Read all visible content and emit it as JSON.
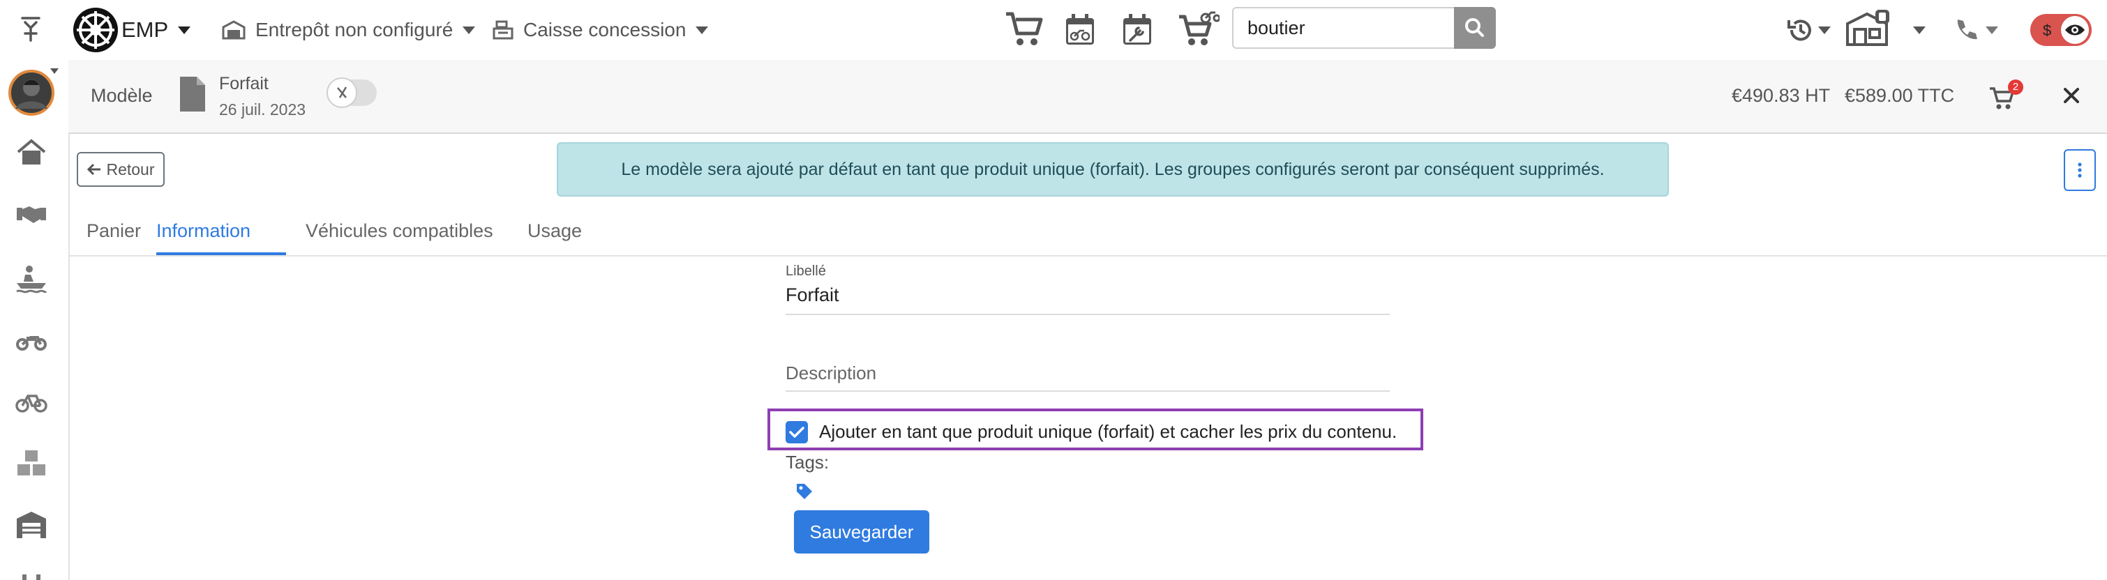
{
  "topbar": {
    "brand": "EMP",
    "warehouse": "Entrepôt non configuré",
    "register": "Caisse concession",
    "search": {
      "value": "boutier",
      "placeholder": ""
    },
    "accent": "#9c9c9c"
  },
  "subheader": {
    "model_label": "Modèle",
    "doc_title": "Forfait",
    "doc_date": "26 juil. 2023",
    "price_ht": "€490.83 HT",
    "price_ttc": "€589.00 TTC",
    "cart_badge": "2",
    "toggle_on": false
  },
  "content": {
    "back_label": "Retour",
    "alert_text": "Le modèle sera ajouté par défaut en tant que produit unique (forfait). Les groupes configurés seront par conséquent supprimés.",
    "tabs": [
      {
        "label": "Panier",
        "active": false
      },
      {
        "label": "Information",
        "active": true
      },
      {
        "label": "Véhicules compatibles",
        "active": false
      },
      {
        "label": "Usage",
        "active": false
      }
    ],
    "form": {
      "libelle_label": "Libellé",
      "libelle_value": "Forfait",
      "description_label": "Description",
      "checkbox_label": "Ajouter en tant que produit unique (forfait) et cacher les prix du contenu.",
      "checkbox_checked": true,
      "tags_label": "Tags:",
      "save_label": "Sauvegarder"
    }
  },
  "colors": {
    "primary": "#2f7be0",
    "alert_bg": "#bfe4e8",
    "alert_border": "#9fd1d7",
    "highlight": "#8e3fb3",
    "badge": "#e53935",
    "danger_toggle": "#d9534f"
  },
  "icons": [
    "pin-icon",
    "logo-icon",
    "warehouse-icon",
    "cash-register-icon",
    "cart-icon",
    "moto-calendar-icon",
    "repair-calendar-icon",
    "moto-cart-icon",
    "search-icon",
    "history-icon",
    "shop-icon",
    "phone-icon",
    "eye-icon",
    "home-icon",
    "handshake-icon",
    "boat-icon",
    "motorbike-icon",
    "bicycle-icon",
    "boxes-icon",
    "garage-icon",
    "document-icon",
    "arrow-left-icon",
    "kebab-icon",
    "tag-icon",
    "close-icon"
  ]
}
